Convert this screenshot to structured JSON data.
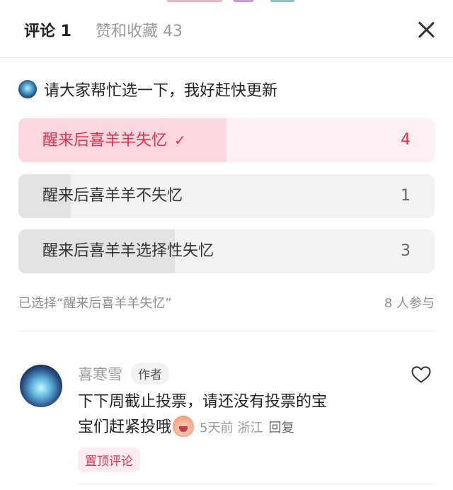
{
  "header": {
    "tab_comments": "评论 1",
    "tab_likes": "赞和收藏 43"
  },
  "poll": {
    "title": "请大家帮忙选一下，我好赶快更新",
    "options": [
      {
        "label": "醒来后喜羊羊失忆",
        "count": "4",
        "selected": true,
        "share": 0.5
      },
      {
        "label": "醒来后喜羊羊不失忆",
        "count": "1",
        "selected": false,
        "share": 0.125
      },
      {
        "label": "醒来后喜羊羊选择性失忆",
        "count": "3",
        "selected": false,
        "share": 0.375
      }
    ],
    "selected_summary": "已选择“醒来后喜羊羊失忆”",
    "participants": "8 人参与",
    "check_mark": "✓"
  },
  "comment": {
    "author_name": "喜寒雪",
    "author_badge": "作者",
    "text_line1": "下下周截止投票，请还没有投票的宝",
    "text_line2": "宝们赶紧投哦",
    "time": "5天前",
    "location": "浙江",
    "reply_label": "回复",
    "pinned_label": "置顶评论"
  },
  "colors": {
    "accent": "#e4304f",
    "selected_bg": "#fdf0f2",
    "selected_fill": "#fbd8dd",
    "option_bg": "#f2f2f2",
    "option_fill": "#e3e3e3"
  },
  "icons": {
    "close": "close-icon",
    "heart": "heart-outline-icon",
    "emoji": "blush-emoji-icon"
  }
}
